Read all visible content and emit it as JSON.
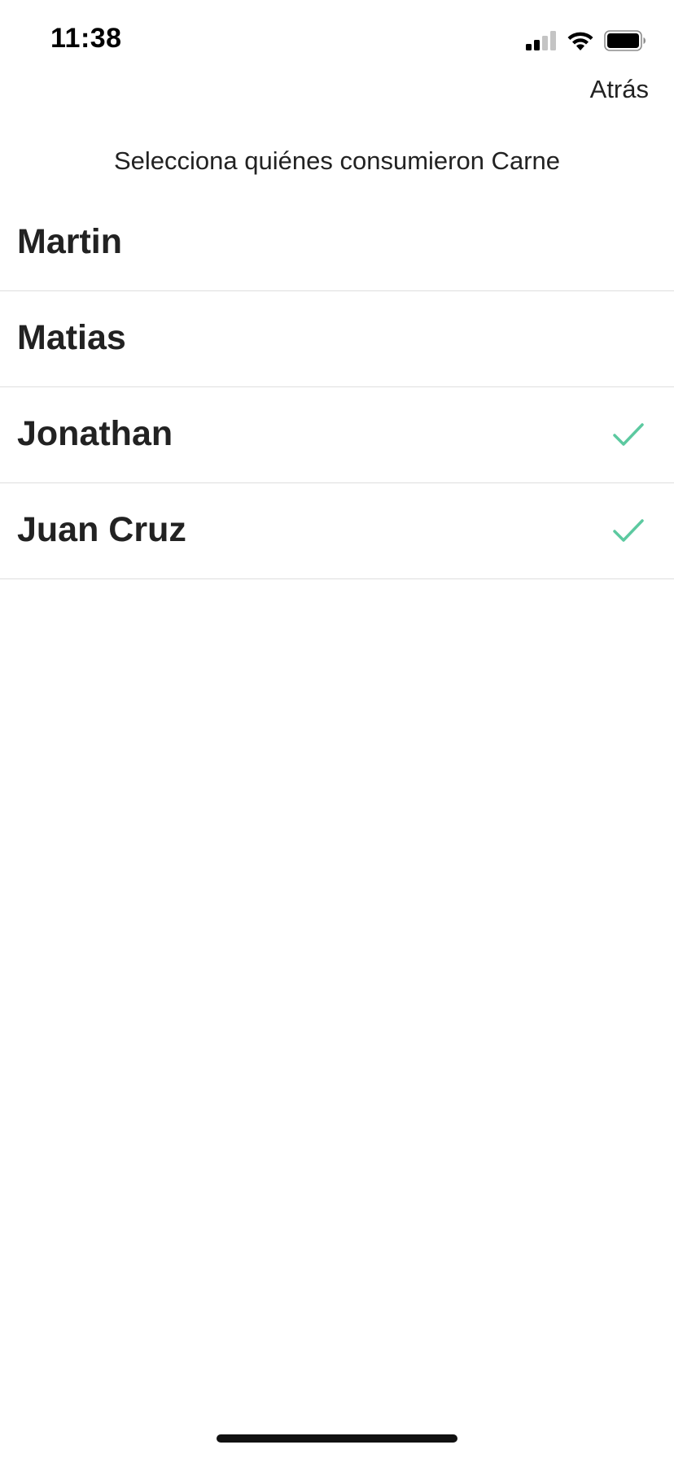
{
  "status_bar": {
    "time": "11:38",
    "icons": [
      "signal-icon",
      "wifi-icon",
      "battery-icon"
    ]
  },
  "header": {
    "back_label": "Atrás"
  },
  "title": "Selecciona quiénes consumieron Carne",
  "people": [
    {
      "name": "Martin",
      "selected": false
    },
    {
      "name": "Matias",
      "selected": false
    },
    {
      "name": "Jonathan",
      "selected": true
    },
    {
      "name": "Juan Cruz",
      "selected": true
    }
  ],
  "colors": {
    "check": "#5cc9a0",
    "text": "#222222",
    "divider": "#dedede"
  }
}
